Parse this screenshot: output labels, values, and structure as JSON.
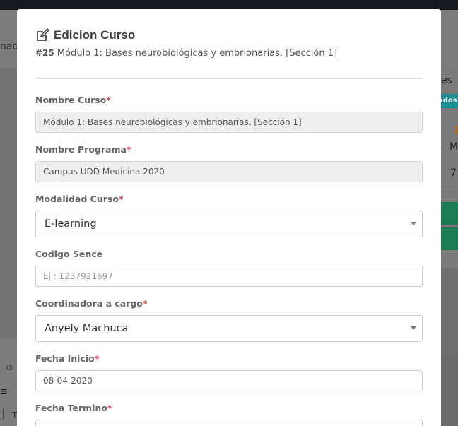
{
  "background": {
    "left_text": "nad",
    "right_text": "es",
    "right_badge": "ados",
    "right_m": "M",
    "right_7": "7",
    "bottom_text": "T"
  },
  "modal": {
    "title": "Edicion Curso",
    "course_number": "#25",
    "course_name": "Módulo 1: Bases neurobiológicas y embrionarias. [Sección 1]",
    "title_icon": "edit-icon"
  },
  "fields": {
    "nombre_curso": {
      "label": "Nombre Curso",
      "required": "*",
      "value": "Módulo 1: Bases neurobiológicas y embrionarias. [Sección 1]"
    },
    "nombre_programa": {
      "label": "Nombre Programa",
      "required": "*",
      "value": "Campus UDD Medicina 2020"
    },
    "modalidad_curso": {
      "label": "Modalidad Curso",
      "required": "*",
      "value": "E-learning"
    },
    "codigo_sence": {
      "label": "Codigo Sence",
      "placeholder": "Ej : 1237921697",
      "value": ""
    },
    "coordinadora": {
      "label": "Coordinadora a cargo",
      "required": "*",
      "value": "Anyely Machuca"
    },
    "fecha_inicio": {
      "label": "Fecha Inicio",
      "required": "*",
      "value": "08-04-2020"
    },
    "fecha_termino": {
      "label": "Fecha Termino",
      "required": "*",
      "value": ""
    }
  },
  "colors": {
    "required": "#e04848",
    "badge": "#1a8f96",
    "green_button": "#1c7d54"
  }
}
